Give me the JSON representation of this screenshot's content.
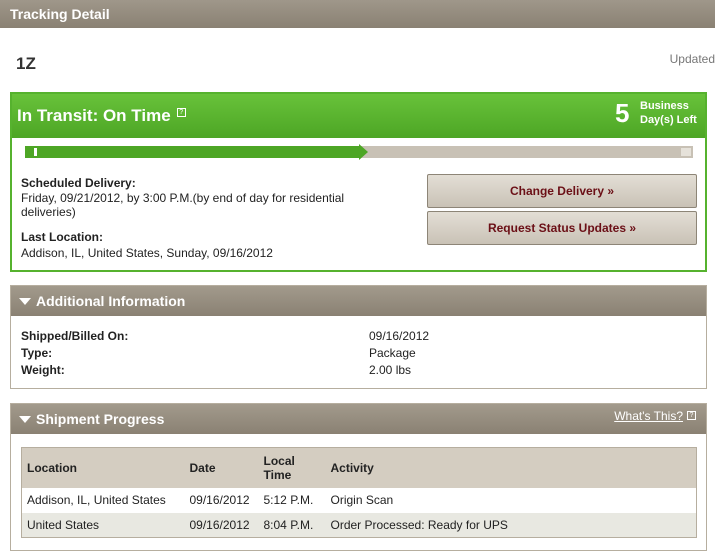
{
  "header": {
    "title": "Tracking Detail"
  },
  "tracking_number": "1Z",
  "updated_label": "Updated",
  "status": {
    "title": "In Transit: On Time",
    "days_left": "5",
    "days_left_line1": "Business",
    "days_left_line2": "Day(s) Left",
    "progress_fraction": 0.5,
    "accent_color": "#4da625",
    "scheduled_label": "Scheduled Delivery:",
    "scheduled_value": "Friday, 09/21/2012, by 3:00 P.M.(by end of day for residential deliveries)",
    "last_location_label": "Last Location:",
    "last_location_value": "Addison, IL, United States, Sunday, 09/16/2012",
    "change_delivery_label": "Change Delivery »",
    "request_updates_label": "Request Status Updates »"
  },
  "additional": {
    "title": "Additional Information",
    "rows": [
      {
        "label": "Shipped/Billed On:",
        "value": "09/16/2012"
      },
      {
        "label": "Type:",
        "value": "Package"
      },
      {
        "label": "Weight:",
        "value": "2.00 lbs"
      }
    ]
  },
  "progress": {
    "title": "Shipment Progress",
    "whats_this": "What's This?",
    "columns": [
      "Location",
      "Date",
      "Local Time",
      "Activity"
    ],
    "rows": [
      [
        "Addison, IL, United States",
        "09/16/2012",
        "5:12 P.M.",
        "Origin Scan"
      ],
      [
        "United States",
        "09/16/2012",
        "8:04 P.M.",
        "Order Processed: Ready for UPS"
      ]
    ]
  }
}
